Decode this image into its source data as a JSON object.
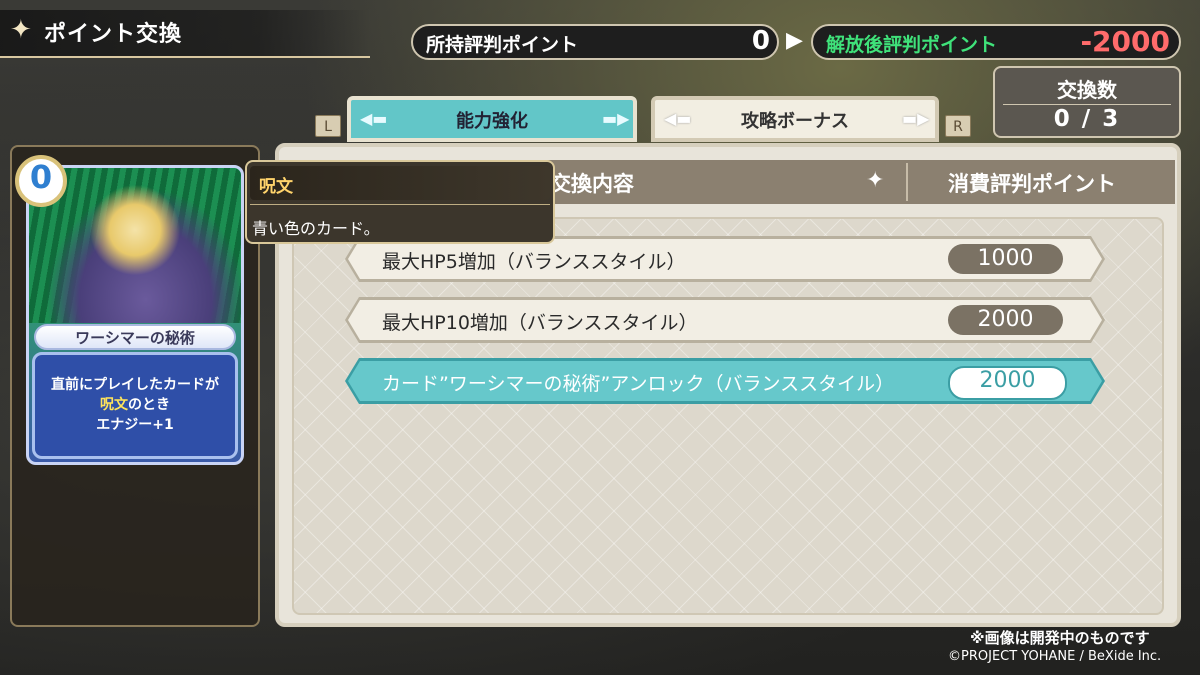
{
  "header": {
    "title": "ポイント交換",
    "owned_label": "所持評判ポイント",
    "owned_value": "0",
    "after_label": "解放後評判ポイント",
    "after_value": "-2000",
    "exchange_label": "交換数",
    "exchange_value": "0 / 3"
  },
  "tabs": [
    {
      "label": "能力強化",
      "active": true
    },
    {
      "label": "攻略ボーナス",
      "active": false
    }
  ],
  "key_hints": {
    "left": "L",
    "right": "R"
  },
  "table": {
    "col_exchange": "交換内容",
    "col_cost": "消費評判ポイント",
    "rows": [
      {
        "label": "最大HP5増加（バランススタイル）",
        "cost": "1000"
      },
      {
        "label": "最大HP10増加（バランススタイル）",
        "cost": "2000"
      },
      {
        "label": "カード”ワーシマーの秘術”アンロック（バランススタイル）",
        "cost": "2000"
      }
    ]
  },
  "card": {
    "cost": "0",
    "name": "ワーシマーの秘術",
    "desc_line1": "直前にプレイしたカードが",
    "desc_line2_hl": "呪文",
    "desc_line2_rest": "のとき",
    "desc_line3": "エナジー+1"
  },
  "tooltip": {
    "title": "呪文",
    "body": "青い色のカード。"
  },
  "footer": {
    "note": "※画像は開発中のものです",
    "copyright": "©PROJECT YOHANE / BeXide Inc."
  },
  "colors": {
    "accent_teal": "#62c6c8",
    "positive_green": "#3fe27a",
    "negative_red": "#ff6b6b",
    "panel_beige": "#e8e4da"
  },
  "icons": [
    "sparkle-icon",
    "arrow-right-icon",
    "tab-arrow-left-icon",
    "tab-arrow-right-icon"
  ]
}
